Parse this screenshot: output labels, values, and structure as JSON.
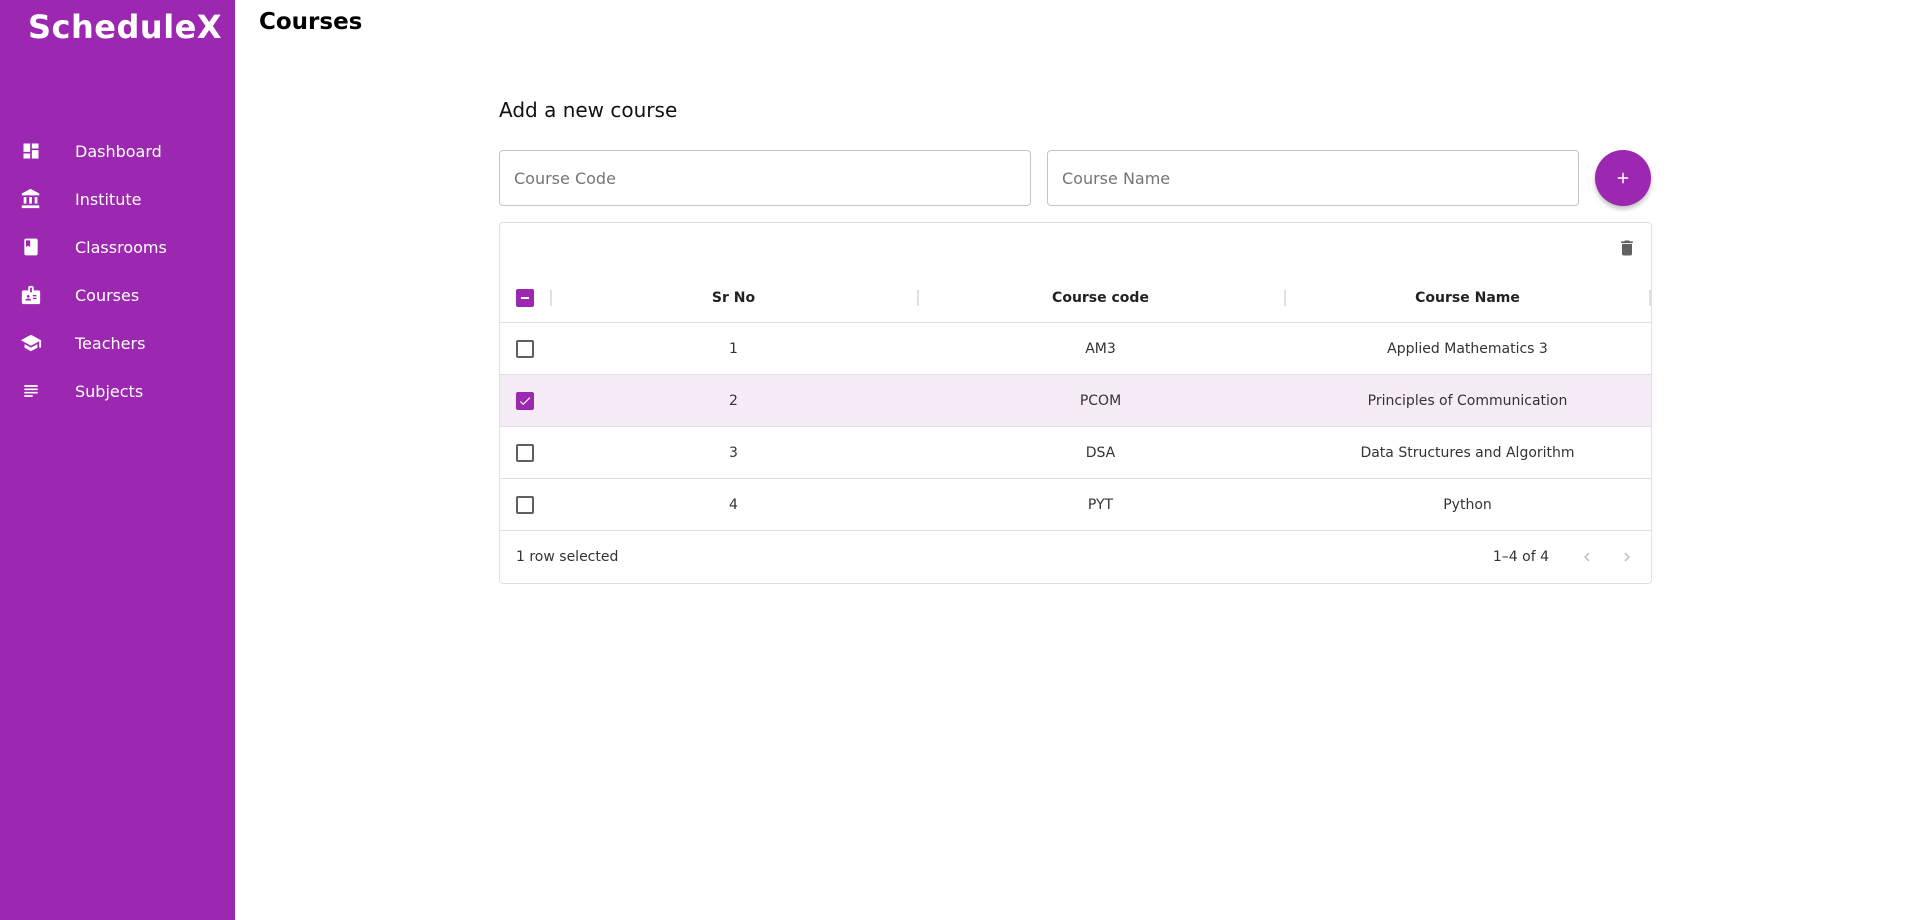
{
  "app": {
    "brand": "ScheduleX"
  },
  "sidebar": {
    "items": [
      {
        "label": "Dashboard",
        "icon": "dashboard-icon"
      },
      {
        "label": "Institute",
        "icon": "institute-icon"
      },
      {
        "label": "Classrooms",
        "icon": "classroom-icon"
      },
      {
        "label": "Courses",
        "icon": "courses-icon"
      },
      {
        "label": "Teachers",
        "icon": "teachers-icon"
      },
      {
        "label": "Subjects",
        "icon": "subjects-icon"
      }
    ]
  },
  "page": {
    "title": "Courses"
  },
  "form": {
    "title": "Add a new course",
    "code_placeholder": "Course Code",
    "name_placeholder": "Course Name",
    "add_icon": "plus-icon"
  },
  "table": {
    "columns": [
      "Sr No",
      "Course code",
      "Course Name"
    ],
    "rows": [
      {
        "sr": "1",
        "code": "AM3",
        "name": "Applied Mathematics 3",
        "selected": false
      },
      {
        "sr": "2",
        "code": "PCOM",
        "name": "Principles of Communication",
        "selected": true
      },
      {
        "sr": "3",
        "code": "DSA",
        "name": "Data Structures and Algorithm",
        "selected": false
      },
      {
        "sr": "4",
        "code": "PYT",
        "name": "Python",
        "selected": false
      }
    ],
    "footer": {
      "selected_text": "1 row selected",
      "range": "1–4 of 4"
    }
  },
  "colors": {
    "accent": "#9c27b0",
    "selected_row": "#f6ecf8"
  }
}
